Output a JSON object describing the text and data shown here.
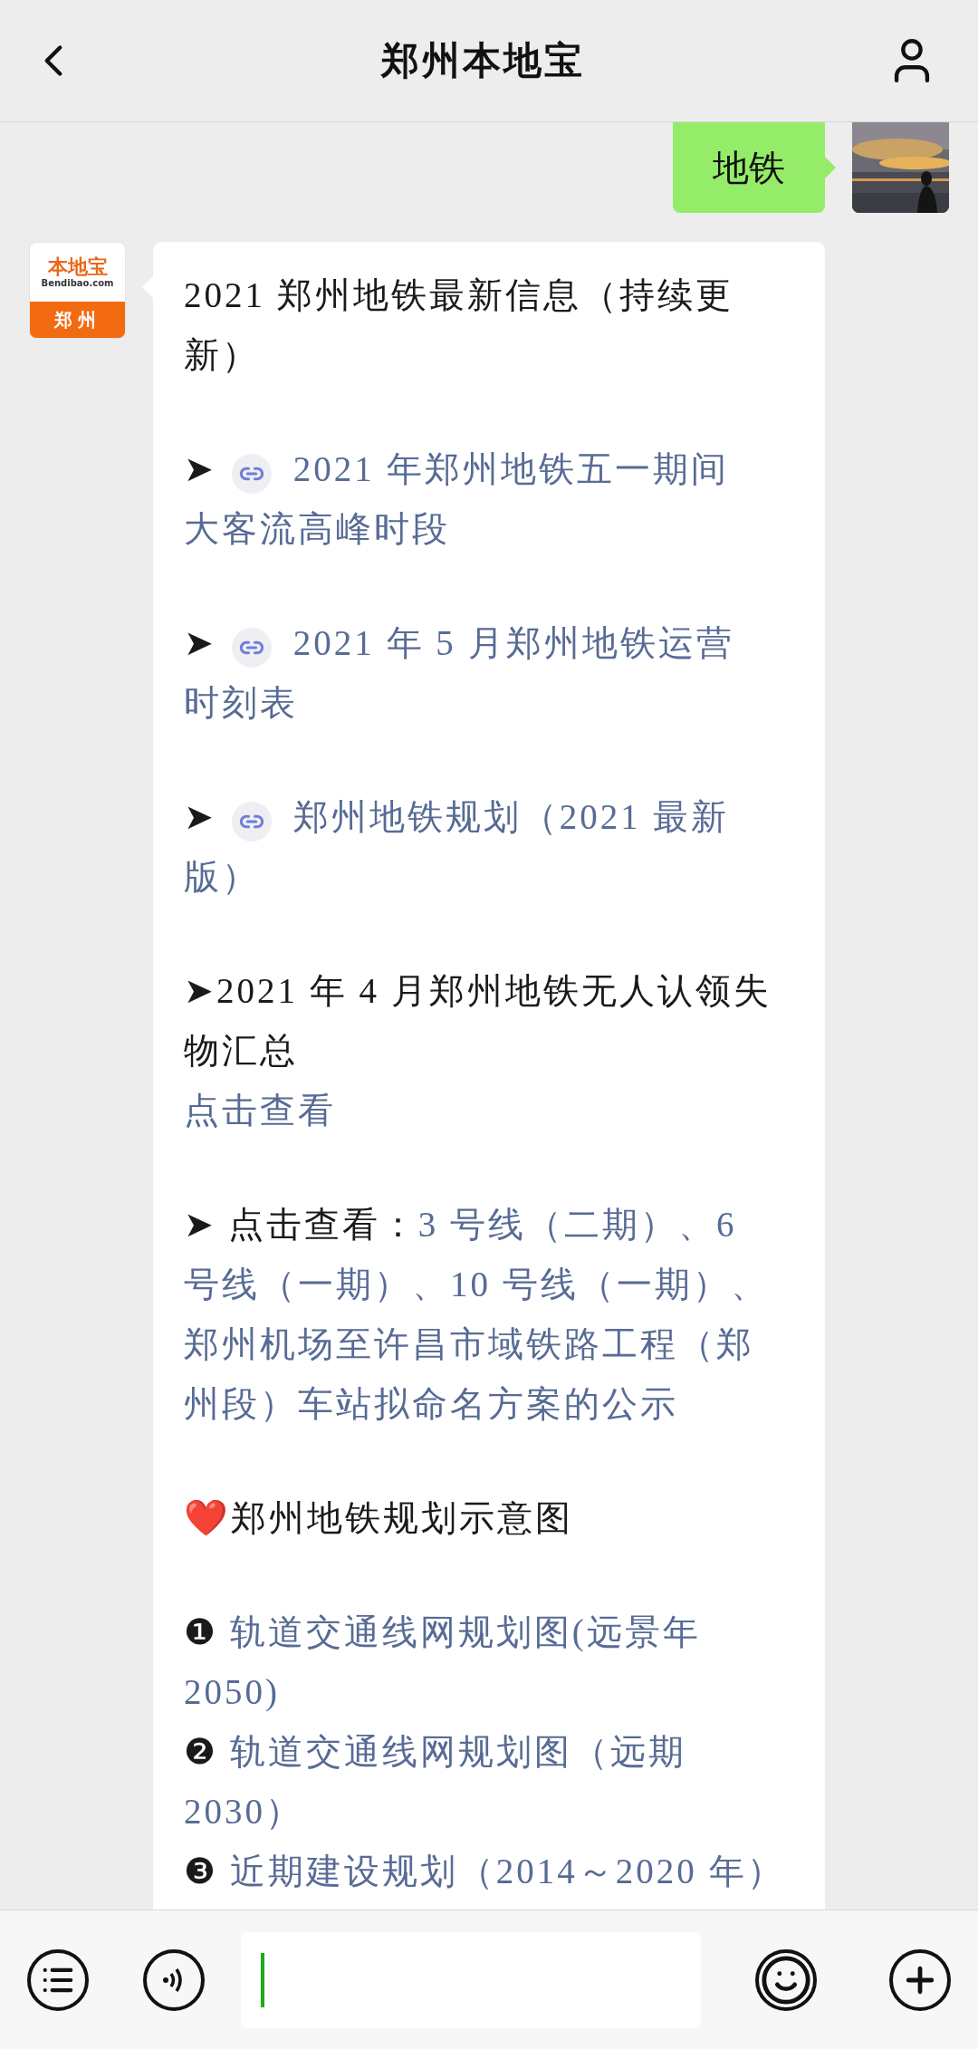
{
  "header": {
    "title": "郑州本地宝"
  },
  "messages": [
    {
      "kind": "sent",
      "text": "地铁"
    },
    {
      "kind": "received",
      "avatar": {
        "logo_top": "本地宝",
        "logo_domain": "Bendibao.com",
        "logo_city": "郑州"
      },
      "paragraphs": [
        {
          "lines": [
            [
              {
                "kind": "text",
                "text": "2021 郑州地铁最新信息（持续更新）",
                "link": false
              }
            ]
          ]
        },
        {
          "lines": [
            [
              {
                "kind": "text",
                "text": "➤ ",
                "link": false
              },
              {
                "kind": "mini_program"
              },
              {
                "kind": "text",
                "text": "2021 年郑州地铁五一期间",
                "link": true
              }
            ],
            [
              {
                "kind": "text",
                "text": "大客流高峰时段",
                "link": true
              }
            ]
          ]
        },
        {
          "lines": [
            [
              {
                "kind": "text",
                "text": "➤ ",
                "link": false
              },
              {
                "kind": "mini_program"
              },
              {
                "kind": "text",
                "text": "2021 年 5 月郑州地铁运营",
                "link": true
              }
            ],
            [
              {
                "kind": "text",
                "text": "时刻表",
                "link": true
              }
            ]
          ]
        },
        {
          "lines": [
            [
              {
                "kind": "text",
                "text": "➤ ",
                "link": false
              },
              {
                "kind": "mini_program"
              },
              {
                "kind": "text",
                "text": "郑州地铁规划（2021 最新",
                "link": true
              }
            ],
            [
              {
                "kind": "text",
                "text": "版）",
                "link": true
              }
            ]
          ]
        },
        {
          "lines": [
            [
              {
                "kind": "text",
                "text": "➤2021 年 4 月郑州地铁无人认领失物汇总",
                "link": false
              }
            ],
            [
              {
                "kind": "text",
                "text": "点击查看",
                "link": true
              }
            ]
          ]
        },
        {
          "lines": [
            [
              {
                "kind": "text",
                "text": "➤ 点击查看：",
                "link": false
              },
              {
                "kind": "text",
                "text": "3 号线（二期）、6",
                "link": true
              }
            ],
            [
              {
                "kind": "text",
                "text": "号线（一期）、10 号线（一期）、",
                "link": true
              }
            ],
            [
              {
                "kind": "text",
                "text": "郑州机场至许昌市域铁路工程（郑",
                "link": true
              }
            ],
            [
              {
                "kind": "text",
                "text": "州段）车站拟命名方案的公示",
                "link": true
              }
            ]
          ]
        },
        {
          "lines": [
            [
              {
                "kind": "text",
                "text": "❤️郑州地铁规划示意图",
                "link": false
              }
            ]
          ]
        },
        {
          "lines": [
            [
              {
                "kind": "text",
                "text": "❶ ",
                "link": false
              },
              {
                "kind": "text",
                "text": "轨道交通线网规划图(远景年",
                "link": true
              }
            ],
            [
              {
                "kind": "text",
                "text": "2050)",
                "link": true
              }
            ],
            [
              {
                "kind": "text",
                "text": "❷ ",
                "link": false
              },
              {
                "kind": "text",
                "text": "轨道交通线网规划图（远期",
                "link": true
              }
            ],
            [
              {
                "kind": "text",
                "text": "2030）",
                "link": true
              }
            ],
            [
              {
                "kind": "text",
                "text": "❸ ",
                "link": false
              },
              {
                "kind": "text",
                "text": "近期建设规划（2014～2020 年）",
                "link": true
              }
            ]
          ]
        }
      ]
    }
  ],
  "composer": {
    "cursor": true
  }
}
